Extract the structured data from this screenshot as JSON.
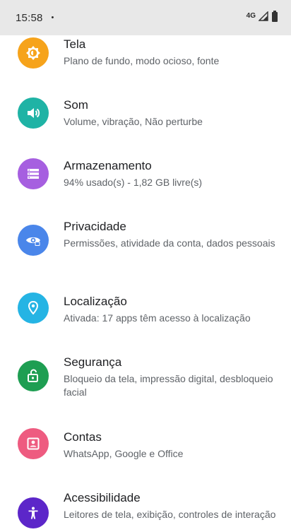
{
  "status_bar": {
    "time": "15:58",
    "dot": "•",
    "network": "4G"
  },
  "settings": [
    {
      "title": "Tela",
      "summary": "Plano de fundo, modo ocioso, fonte",
      "icon": "display-icon",
      "color": "#f6a31b"
    },
    {
      "title": "Som",
      "summary": "Volume, vibração, Não perturbe",
      "icon": "volume-icon",
      "color": "#1fb3a5"
    },
    {
      "title": "Armazenamento",
      "summary": "94% usado(s) - 1,82 GB livre(s)",
      "icon": "storage-icon",
      "color": "#a65fe0"
    },
    {
      "title": "Privacidade",
      "summary": "Permissões, atividade da conta, dados pessoais",
      "icon": "privacy-eye-icon",
      "color": "#4a86ea"
    },
    {
      "title": "Localização",
      "summary": "Ativada: 17 apps têm acesso à localização",
      "icon": "location-pin-icon",
      "color": "#25b4e4"
    },
    {
      "title": "Segurança",
      "summary": "Bloqueio da tela, impressão digital, desbloqueio facial",
      "icon": "unlock-icon",
      "color": "#1e9e52"
    },
    {
      "title": "Contas",
      "summary": "WhatsApp, Google e Office",
      "icon": "account-box-icon",
      "color": "#ee5b80"
    },
    {
      "title": "Acessibilidade",
      "summary": "Leitores de tela, exibição, controles de interação",
      "icon": "accessibility-icon",
      "color": "#5c26c9"
    }
  ]
}
